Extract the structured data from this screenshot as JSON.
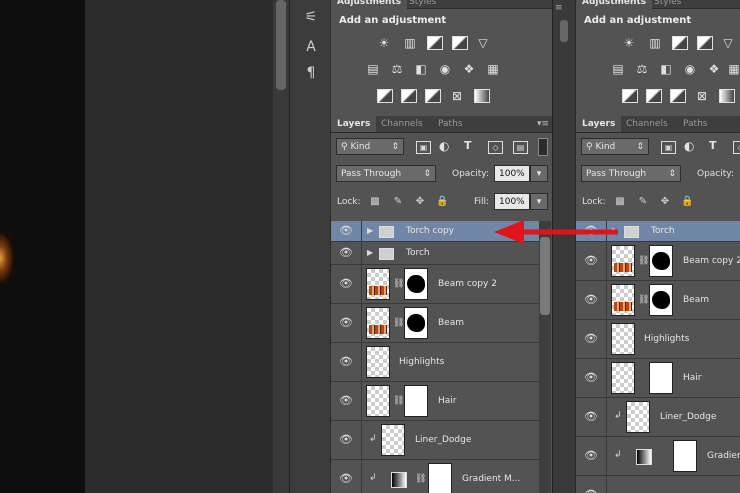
{
  "colors": {
    "selected_layer": "#6f86a6",
    "annotation_arrow": "#e0141a",
    "panel_bg": "#535353"
  },
  "tool_strip": {
    "icons": [
      "brush-settings-icon",
      "character-icon",
      "paragraph-icon"
    ],
    "character_glyph": "A",
    "paragraph_glyph": "¶"
  },
  "left_panel": {
    "adjustments": {
      "tab_adjustments": "Adjustments",
      "tab_styles": "Styles",
      "title": "Add an adjustment"
    },
    "layers_tabs": {
      "layers": "Layers",
      "channels": "Channels",
      "paths": "Paths"
    },
    "filter_kind": "Kind",
    "blend_mode": "Pass Through",
    "opacity_label": "Opacity:",
    "opacity_value": "100%",
    "lock_label": "Lock:",
    "fill_label": "Fill:",
    "fill_value": "100%",
    "layers": [
      {
        "name": "Torch copy",
        "type": "group",
        "selected": true
      },
      {
        "name": "Torch",
        "type": "group",
        "selected": false
      },
      {
        "name": "Beam copy 2",
        "type": "masked"
      },
      {
        "name": "Beam",
        "type": "masked"
      },
      {
        "name": "Highlights",
        "type": "plain"
      },
      {
        "name": "Hair",
        "type": "masked-white"
      },
      {
        "name": "Liner_Dodge",
        "type": "clipped"
      },
      {
        "name": "Gradient M...",
        "type": "gradient"
      }
    ]
  },
  "right_panel": {
    "adjustments": {
      "tab_adjustments": "Adjustments",
      "tab_styles": "Styles",
      "title": "Add an adjustment"
    },
    "layers_tabs": {
      "layers": "Layers",
      "channels": "Channels",
      "paths": "Paths"
    },
    "filter_kind": "Kind",
    "blend_mode": "Pass Through",
    "opacity_label": "Opacity:",
    "lock_label": "Lock:",
    "layers": [
      {
        "name": "Torch",
        "type": "group",
        "selected": true
      },
      {
        "name": "Beam copy 2",
        "type": "masked"
      },
      {
        "name": "Beam",
        "type": "masked"
      },
      {
        "name": "Highlights",
        "type": "plain"
      },
      {
        "name": "Hair",
        "type": "masked-white"
      },
      {
        "name": "Liner_Dodge",
        "type": "clipped"
      },
      {
        "name": "Gradien",
        "type": "gradient"
      }
    ]
  }
}
